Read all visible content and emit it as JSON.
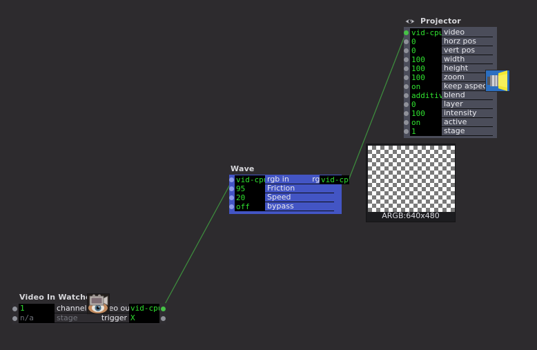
{
  "canvas": {
    "background": "#2d2b2e",
    "wire_color": "#3d8b3d"
  },
  "nodes": {
    "projector": {
      "title": "Projector",
      "icon": "eye-icon",
      "body_color": "#4b4d5a",
      "thumbnail_icon": "projector-icon",
      "params": [
        {
          "value": "vid-cpu",
          "label": "video",
          "port": "green"
        },
        {
          "value": "0",
          "label": "horz pos",
          "port": "gray"
        },
        {
          "value": "0",
          "label": "vert pos",
          "port": "gray"
        },
        {
          "value": "100",
          "label": "width",
          "port": "gray"
        },
        {
          "value": "100",
          "label": "height",
          "port": "gray"
        },
        {
          "value": "100",
          "label": "zoom",
          "port": "gray"
        },
        {
          "value": "on",
          "label": "keep aspect",
          "port": "gray"
        },
        {
          "value": "additive",
          "label": "blend",
          "port": "gray"
        },
        {
          "value": "0",
          "label": "layer",
          "port": "gray"
        },
        {
          "value": "100",
          "label": "intensity",
          "port": "gray"
        },
        {
          "value": "on",
          "label": "active",
          "port": "gray"
        },
        {
          "value": "1",
          "label": "stage",
          "port": "gray"
        }
      ]
    },
    "wave": {
      "title": "Wave",
      "body_color": "#4355c4",
      "input_value": "vid-cpu",
      "input_label": "rgb in",
      "output_label": "rgb out",
      "output_value": "vid-cpu",
      "params": [
        {
          "value": "95",
          "label": "Friction",
          "port": "blue"
        },
        {
          "value": "20",
          "label": "Speed",
          "port": "blue"
        },
        {
          "value": "off",
          "label": "bypass",
          "port": "blue"
        }
      ]
    },
    "video_in_watcher": {
      "title": "Video In Watcher",
      "thumbnail_icon": "camera-eye-icon",
      "rows": [
        {
          "in_value": "1",
          "in_label": "channel",
          "in_dim": false,
          "out_label": "video out",
          "out_value": "vid-cpu",
          "out_port": "green"
        },
        {
          "in_value": "n/a",
          "in_label": "stage",
          "in_dim": true,
          "out_label": "trigger",
          "out_value": "X",
          "out_port": "gray"
        }
      ]
    }
  },
  "preview": {
    "caption": "ARGB:640x480"
  }
}
